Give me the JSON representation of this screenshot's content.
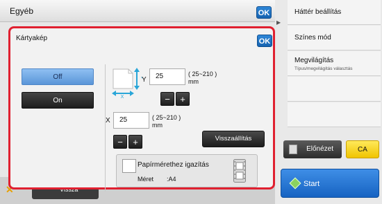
{
  "background": {
    "title": "Egyéb",
    "ok_label": "OK",
    "back_label": "Vissza"
  },
  "side_panel": {
    "items": [
      {
        "label": "Háttér beállítás"
      },
      {
        "label": "Színes mód"
      },
      {
        "label": "Megvilágítás",
        "sub": "Típus/megvilágítás választás"
      }
    ],
    "preview_label": "Előnézet",
    "ca_label": "CA",
    "start_label": "Start"
  },
  "popup": {
    "title": "Kártyakép",
    "ok_label": "OK",
    "mode_off": "Off",
    "mode_on": "On",
    "y_label": "Y",
    "y_value": "25",
    "y_range": "( 25~210 )",
    "y_unit": "mm",
    "x_label": "X",
    "x_value": "25",
    "x_range": "( 25~210 )",
    "x_unit": "mm",
    "minus": "−",
    "plus": "+",
    "reset_label": "Visszaállítás",
    "fit_label": "Papírmérethez igazítás",
    "size_label": "Méret",
    "size_value": ":A4"
  },
  "colors": {
    "highlight_border": "#e02030",
    "ok_blue": "#1e74c8",
    "off_selected": "#6ea6e2",
    "ca_yellow": "#f5d21e",
    "start_blue": "#2e7ad6"
  }
}
